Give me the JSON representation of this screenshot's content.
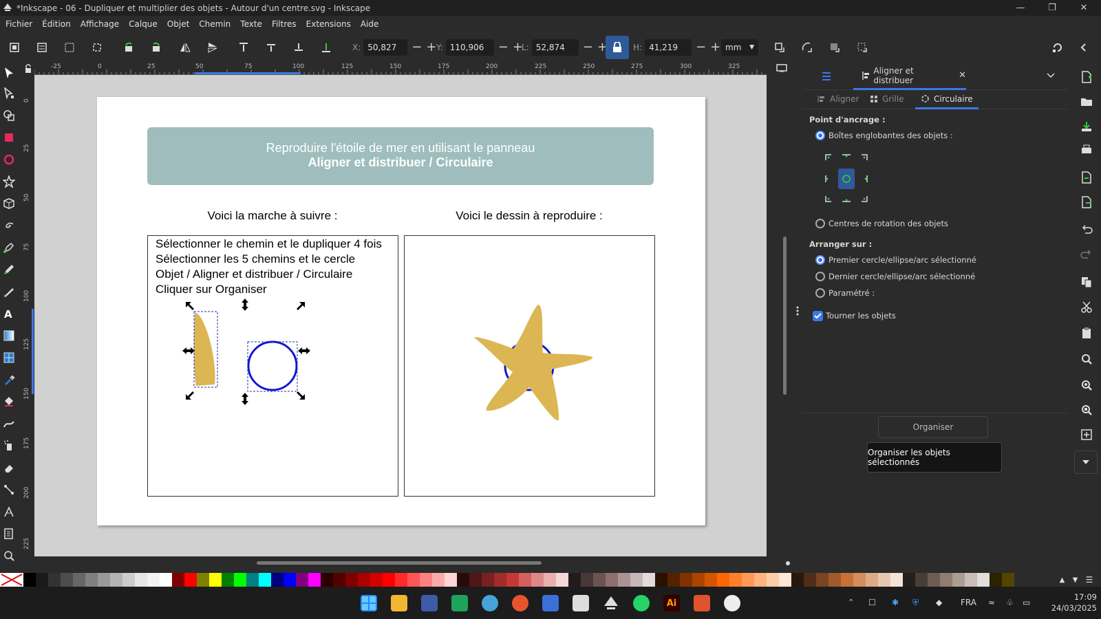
{
  "window": {
    "title": "*Inkscape - 06 - Dupliquer et multiplier des objets - Autour d'un centre.svg - Inkscape"
  },
  "menu": [
    "Fichier",
    "Édition",
    "Affichage",
    "Calque",
    "Objet",
    "Chemin",
    "Texte",
    "Filtres",
    "Extensions",
    "Aide"
  ],
  "toolbar": {
    "x_label": "X:",
    "x_value": "50,827",
    "y_label": "Y:",
    "y_value": "110,906",
    "w_label": "L:",
    "w_value": "52,874",
    "h_label": "H:",
    "h_value": "41,219",
    "unit": "mm"
  },
  "ruler": {
    "top": [
      "-25",
      "0",
      "25",
      "50",
      "75",
      "100",
      "125",
      "150",
      "175",
      "200",
      "225",
      "250",
      "275",
      "300",
      "325"
    ],
    "left": [
      "0",
      "25",
      "50",
      "75",
      "100",
      "125",
      "150",
      "175",
      "200",
      "225"
    ]
  },
  "document": {
    "banner_line1": "Reproduire l'étoile de mer en utilisant le panneau",
    "banner_line2": "Aligner et distribuer / Circulaire",
    "left_heading": "Voici la marche à suivre :",
    "right_heading": "Voici le dessin à reproduire :",
    "steps": [
      "Sélectionner le chemin et le dupliquer 4 fois",
      "Sélectionner les 5 chemins et le cercle",
      "Objet / Aligner et distribuer / Circulaire",
      "Cliquer sur Organiser"
    ]
  },
  "dock": {
    "tab_title": "Aligner et distribuer",
    "subtabs": [
      "Aligner",
      "Grille",
      "Circulaire"
    ],
    "anchor_title": "Point d'ancrage :",
    "anchor_bbox": "Boîtes englobantes des objets :",
    "anchor_rotation": "Centres de rotation des objets",
    "arrange_title": "Arranger sur :",
    "arrange_first": "Premier cercle/ellipse/arc sélectionné",
    "arrange_last": "Dernier cercle/ellipse/arc sélectionné",
    "arrange_param": "Paramétré :",
    "rotate_objects": "Tourner les objets",
    "organise_button": "Organiser",
    "tooltip": "Organiser les objets sélectionnés"
  },
  "colors": {
    "accent": "#3b78e7",
    "banner": "#9fbdbd",
    "starfish": "#dcb653",
    "circle": "#1515d0"
  },
  "palette": [
    "#000000",
    "#1a1a1a",
    "#333333",
    "#4d4d4d",
    "#666666",
    "#808080",
    "#999999",
    "#b3b3b3",
    "#cccccc",
    "#e6e6e6",
    "#f2f2f2",
    "#ffffff",
    "#800000",
    "#ff0000",
    "#808000",
    "#ffff00",
    "#008000",
    "#00ff00",
    "#008080",
    "#00ffff",
    "#000080",
    "#0000ff",
    "#800080",
    "#ff00ff",
    "#2b0000",
    "#550000",
    "#800000",
    "#aa0000",
    "#d40000",
    "#ff0000",
    "#ff2a2a",
    "#ff5555",
    "#ff8080",
    "#ffaaaa",
    "#ffd5d5",
    "#280b0b",
    "#501616",
    "#782121",
    "#a02c2c",
    "#c83737",
    "#d35f5f",
    "#de8787",
    "#e9afaf",
    "#f4d7d7",
    "#241c1c",
    "#483737",
    "#6c5353",
    "#916f6f",
    "#ac9393",
    "#c8b7b7",
    "#e3dbdb",
    "#2b1100",
    "#552200",
    "#803300",
    "#aa4400",
    "#d45500",
    "#ff6600",
    "#ff7f2a",
    "#ff9955",
    "#ffb380",
    "#ffccaa",
    "#ffe6d5",
    "#28170b",
    "#502d16",
    "#784421",
    "#a05a2c",
    "#c87137",
    "#d38d5f",
    "#deaa87",
    "#e9c6af",
    "#f4e3d7",
    "#241f1c",
    "#483e37",
    "#6c5d53",
    "#917c6f",
    "#ac9d93",
    "#c8beb7",
    "#e3dedb",
    "#2b2200",
    "#554400"
  ],
  "taskbar": {
    "lang": "FRA",
    "time": "17:09",
    "date": "24/03/2025"
  }
}
